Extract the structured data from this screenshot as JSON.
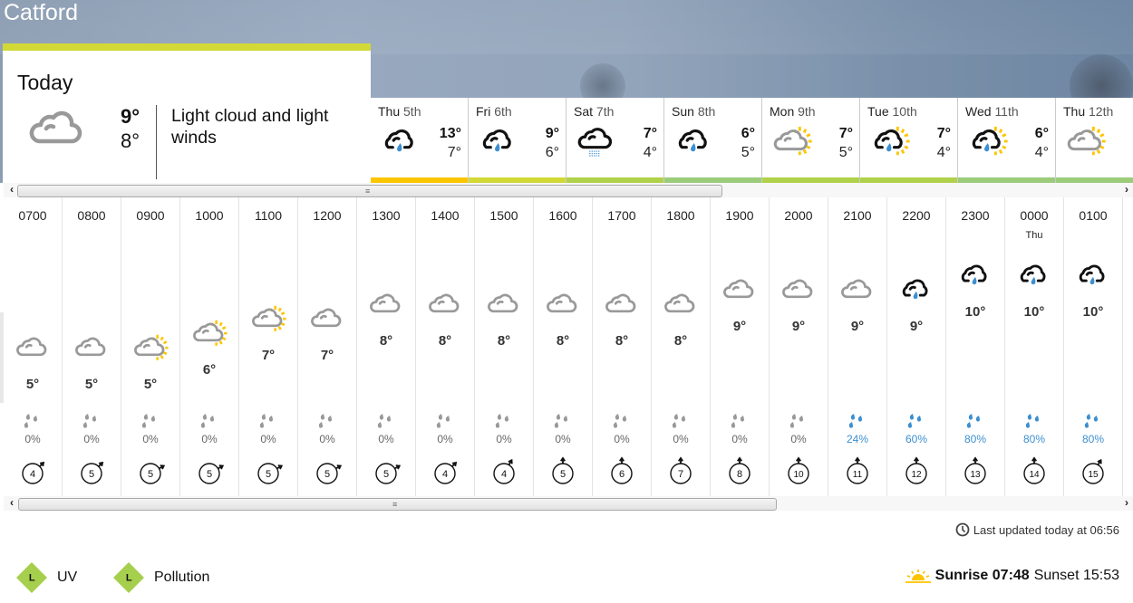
{
  "location": "Catford",
  "today": {
    "title": "Today",
    "icon": "light-cloud-icon",
    "high": "9°",
    "low": "8°",
    "description": "Light cloud and light winds",
    "accent_color": "#d2d937"
  },
  "days": [
    {
      "weekday": "Thu",
      "date": "5th",
      "icon": "light-rain-icon",
      "high": "13°",
      "low": "7°",
      "bar_color": "#fdc500"
    },
    {
      "weekday": "Fri",
      "date": "6th",
      "icon": "light-rain-icon",
      "high": "9°",
      "low": "6°",
      "bar_color": "#d2d937"
    },
    {
      "weekday": "Sat",
      "date": "7th",
      "icon": "drizzle-icon",
      "high": "7°",
      "low": "4°",
      "bar_color": "#b0d14a"
    },
    {
      "weekday": "Sun",
      "date": "8th",
      "icon": "light-rain-icon",
      "high": "6°",
      "low": "5°",
      "bar_color": "#9ccb7a"
    },
    {
      "weekday": "Mon",
      "date": "9th",
      "icon": "sunny-intervals-icon",
      "high": "7°",
      "low": "5°",
      "bar_color": "#b0d14a"
    },
    {
      "weekday": "Tue",
      "date": "10th",
      "icon": "light-rain-showers-icon",
      "high": "7°",
      "low": "4°",
      "bar_color": "#b0d14a"
    },
    {
      "weekday": "Wed",
      "date": "11th",
      "icon": "light-rain-showers-icon",
      "high": "6°",
      "low": "4°",
      "bar_color": "#9ccb7a"
    },
    {
      "weekday": "Thu",
      "date": "12th",
      "icon": "sunny-intervals-icon",
      "high": "",
      "low": "",
      "bar_color": "#9ccb7a"
    }
  ],
  "hours": [
    {
      "time": "0700",
      "day": "",
      "icon": "light-cloud-icon",
      "temp": "5°",
      "rain_pct": "0%",
      "wind_speed": "4",
      "wind_dir": 45
    },
    {
      "time": "0800",
      "day": "",
      "icon": "light-cloud-icon",
      "temp": "5°",
      "rain_pct": "0%",
      "wind_speed": "5",
      "wind_dir": 45
    },
    {
      "time": "0900",
      "day": "",
      "icon": "sunny-intervals-icon",
      "temp": "5°",
      "rain_pct": "0%",
      "wind_speed": "5",
      "wind_dir": 60
    },
    {
      "time": "1000",
      "day": "",
      "icon": "sunny-intervals-icon",
      "temp": "6°",
      "rain_pct": "0%",
      "wind_speed": "5",
      "wind_dir": 60
    },
    {
      "time": "1100",
      "day": "",
      "icon": "sunny-intervals-icon",
      "temp": "7°",
      "rain_pct": "0%",
      "wind_speed": "5",
      "wind_dir": 60
    },
    {
      "time": "1200",
      "day": "",
      "icon": "light-cloud-icon",
      "temp": "7°",
      "rain_pct": "0%",
      "wind_speed": "5",
      "wind_dir": 60
    },
    {
      "time": "1300",
      "day": "",
      "icon": "light-cloud-icon",
      "temp": "8°",
      "rain_pct": "0%",
      "wind_speed": "5",
      "wind_dir": 60
    },
    {
      "time": "1400",
      "day": "",
      "icon": "light-cloud-icon",
      "temp": "8°",
      "rain_pct": "0%",
      "wind_speed": "4",
      "wind_dir": 45
    },
    {
      "time": "1500",
      "day": "",
      "icon": "light-cloud-icon",
      "temp": "8°",
      "rain_pct": "0%",
      "wind_speed": "4",
      "wind_dir": 30
    },
    {
      "time": "1600",
      "day": "",
      "icon": "light-cloud-icon",
      "temp": "8°",
      "rain_pct": "0%",
      "wind_speed": "5",
      "wind_dir": 0
    },
    {
      "time": "1700",
      "day": "",
      "icon": "light-cloud-icon",
      "temp": "8°",
      "rain_pct": "0%",
      "wind_speed": "6",
      "wind_dir": 0
    },
    {
      "time": "1800",
      "day": "",
      "icon": "light-cloud-icon",
      "temp": "8°",
      "rain_pct": "0%",
      "wind_speed": "7",
      "wind_dir": 0
    },
    {
      "time": "1900",
      "day": "",
      "icon": "light-cloud-icon",
      "temp": "9°",
      "rain_pct": "0%",
      "wind_speed": "8",
      "wind_dir": 0
    },
    {
      "time": "2000",
      "day": "",
      "icon": "light-cloud-icon",
      "temp": "9°",
      "rain_pct": "0%",
      "wind_speed": "10",
      "wind_dir": 0
    },
    {
      "time": "2100",
      "day": "",
      "icon": "light-cloud-icon",
      "temp": "9°",
      "rain_pct": "24%",
      "wind_speed": "11",
      "wind_dir": 0
    },
    {
      "time": "2200",
      "day": "",
      "icon": "light-rain-icon",
      "temp": "9°",
      "rain_pct": "60%",
      "wind_speed": "12",
      "wind_dir": 0
    },
    {
      "time": "2300",
      "day": "",
      "icon": "light-rain-icon",
      "temp": "10°",
      "rain_pct": "80%",
      "wind_speed": "13",
      "wind_dir": 0
    },
    {
      "time": "0000",
      "day": "Thu",
      "icon": "light-rain-icon",
      "temp": "10°",
      "rain_pct": "80%",
      "wind_speed": "14",
      "wind_dir": 0
    },
    {
      "time": "0100",
      "day": "",
      "icon": "light-rain-icon",
      "temp": "10°",
      "rain_pct": "80%",
      "wind_speed": "15",
      "wind_dir": 30
    }
  ],
  "footer": {
    "last_updated": "Last updated today at 06:56",
    "uv_level": "L",
    "uv_label": "UV",
    "pollution_level": "L",
    "pollution_label": "Pollution",
    "sunrise_label": "Sunrise 07:48",
    "sunset_label": "Sunset 15:53"
  },
  "colors": {
    "rain_blue": "#3c8fd1",
    "sun_yellow": "#fdc500",
    "badge_green": "#a5cf4c"
  }
}
